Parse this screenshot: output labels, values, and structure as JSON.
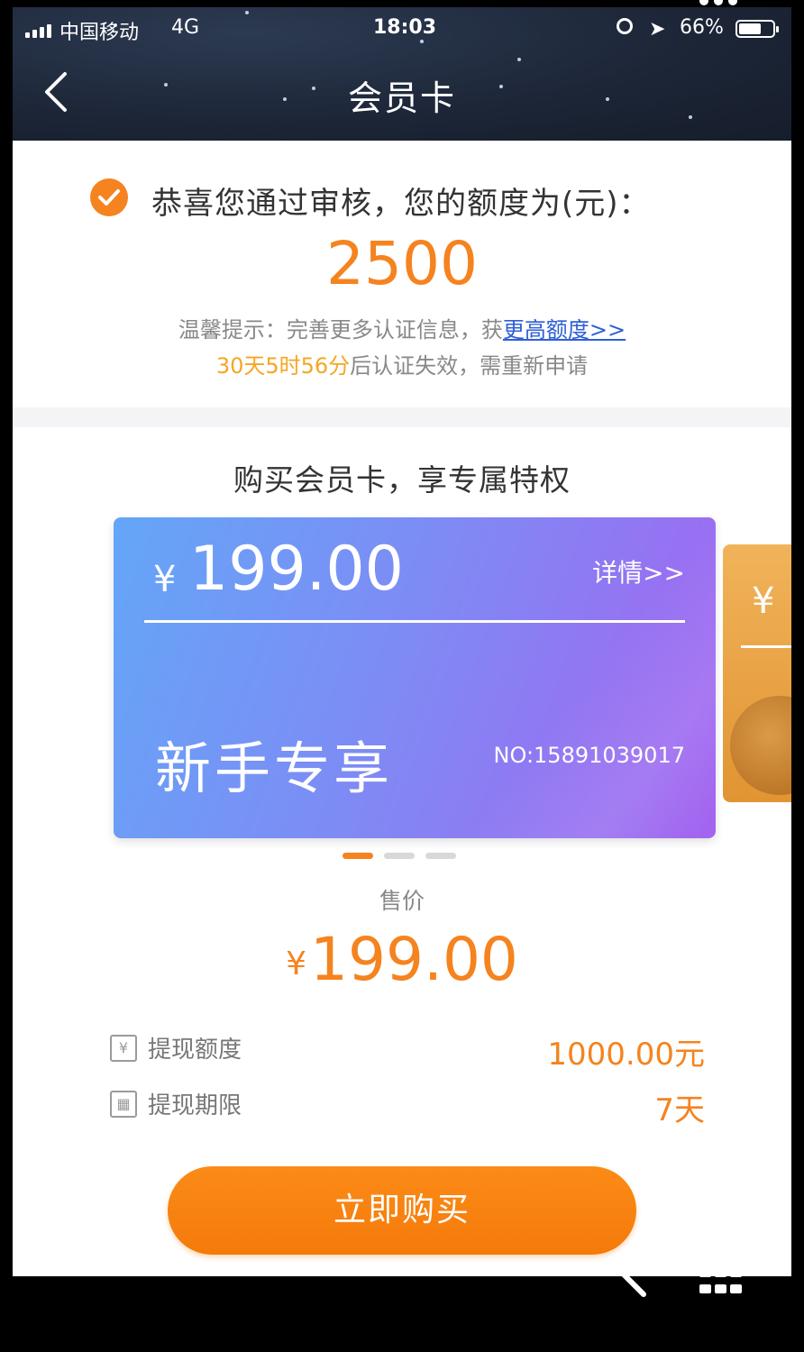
{
  "status_bar": {
    "carrier": "中国移动",
    "network": "4G",
    "time": "18:03",
    "battery_percent": "66%",
    "battery_level": 0.66
  },
  "nav": {
    "title": "会员卡",
    "back_icon": "chevron-left-icon"
  },
  "approval": {
    "message": "恭喜您通过审核，您的额度为(元)：",
    "amount": "2500",
    "tip_prefix": "温馨提示：完善更多认证信息，获",
    "tip_link": "更高额度>>",
    "expire_countdown": "30天5时56分",
    "expire_suffix": "后认证失效，需重新申请"
  },
  "membership": {
    "section_title": "购买会员卡，享专属特权",
    "card": {
      "currency": "¥",
      "price": "199.00",
      "detail_link": "详情>>",
      "name": "新手专享",
      "number": "NO:15891039017"
    },
    "next_card": {
      "currency": "¥"
    },
    "carousel": {
      "count": 3,
      "active_index": 0
    }
  },
  "pricing": {
    "label": "售价",
    "currency": "¥",
    "price": "199.00"
  },
  "details": [
    {
      "icon": "money-card-icon",
      "label": "提现额度",
      "value": "1000.00元"
    },
    {
      "icon": "calendar-icon",
      "label": "提现期限",
      "value": "7天"
    }
  ],
  "buy_button": "立即购买",
  "colors": {
    "accent": "#f5831f",
    "link": "#2f5fd6",
    "header_bg": "#1c2536"
  }
}
